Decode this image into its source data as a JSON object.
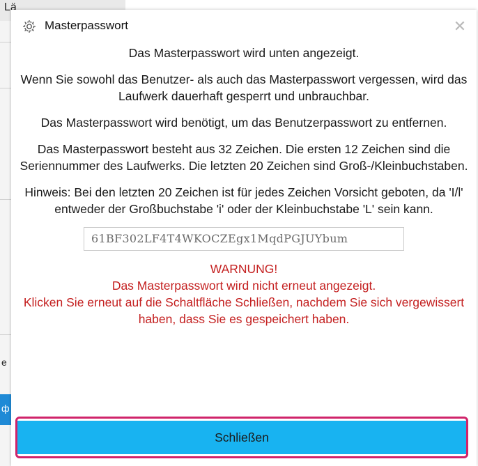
{
  "background": {
    "top_left_text": "Lä",
    "left_letters": [
      "e",
      "ф"
    ]
  },
  "dialog": {
    "title": "Masterpasswort",
    "close_symbol": "✕",
    "paragraphs": [
      "Das Masterpasswort wird unten angezeigt.",
      "Wenn Sie sowohl das Benutzer- als auch das Masterpasswort vergessen, wird das Laufwerk dauerhaft gesperrt und unbrauchbar.",
      "Das Masterpasswort wird benötigt, um das Benutzerpasswort zu entfernen.",
      "Das Masterpasswort besteht aus 32 Zeichen. Die ersten 12 Zeichen sind die Seriennummer des Laufwerks. Die letzten 20 Zeichen sind Groß-/Kleinbuchstaben.",
      "Hinweis: Bei den letzten 20 Zeichen ist für jedes Zeichen Vorsicht geboten, da 'I/l' entweder der Großbuchstabe 'i' oder der Kleinbuchstabe 'L' sein kann."
    ],
    "password_value": "61BF302LF4T4WKOCZEgx1MqdPGJUYbum",
    "warning": {
      "heading": "WARNUNG!",
      "line1": "Das Masterpasswort wird nicht erneut angezeigt.",
      "line2": "Klicken Sie erneut auf die Schaltfläche Schließen, nachdem Sie sich vergewissert haben, dass Sie es gespeichert haben."
    },
    "close_button_label": "Schließen"
  },
  "colors": {
    "warning": "#c42020",
    "button": "#18b3f1",
    "highlight": "#d0246a"
  }
}
